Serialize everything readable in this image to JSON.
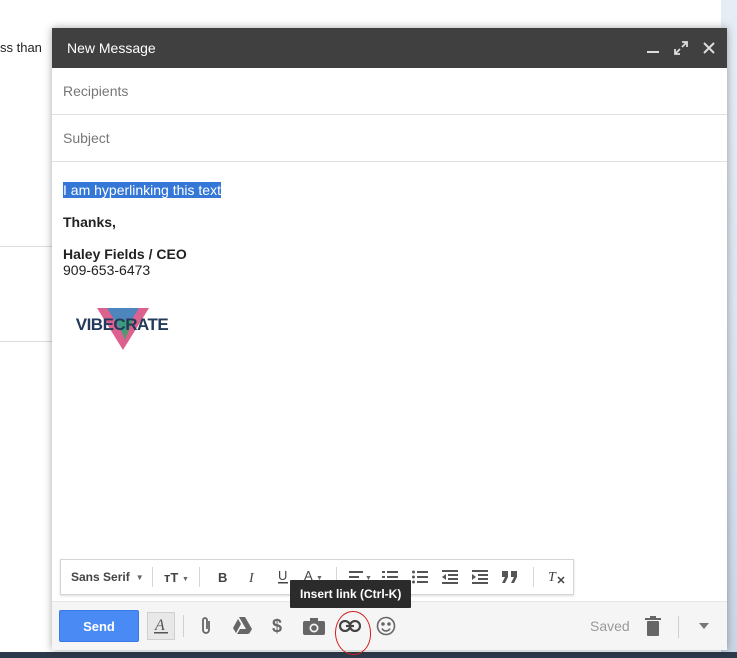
{
  "background": {
    "snippet": "ss than"
  },
  "compose": {
    "title": "New Message",
    "recipients_placeholder": "Recipients",
    "subject_placeholder": "Subject",
    "body": {
      "selected_text": "I am hyperlinking this text",
      "closing": "Thanks,",
      "signature_name": "Haley Fields / CEO",
      "signature_phone": "909-653-6473",
      "logo_text": "VIBECRATE"
    },
    "format_bar": {
      "font": "Sans Serif"
    },
    "toolbar": {
      "send_label": "Send",
      "saved_label": "Saved",
      "tooltip": "Insert link (Ctrl-K)"
    },
    "colors": {
      "send": "#4a8af4",
      "titlebar": "#404040",
      "selection": "#3477d6",
      "annotation": "#d42020"
    },
    "icons": [
      "minimize-icon",
      "expand-icon",
      "close-icon",
      "format-text-icon",
      "attach-icon",
      "drive-icon",
      "dollar-icon",
      "camera-icon",
      "link-icon",
      "emoji-icon",
      "trash-icon",
      "chevron-down-icon"
    ]
  }
}
